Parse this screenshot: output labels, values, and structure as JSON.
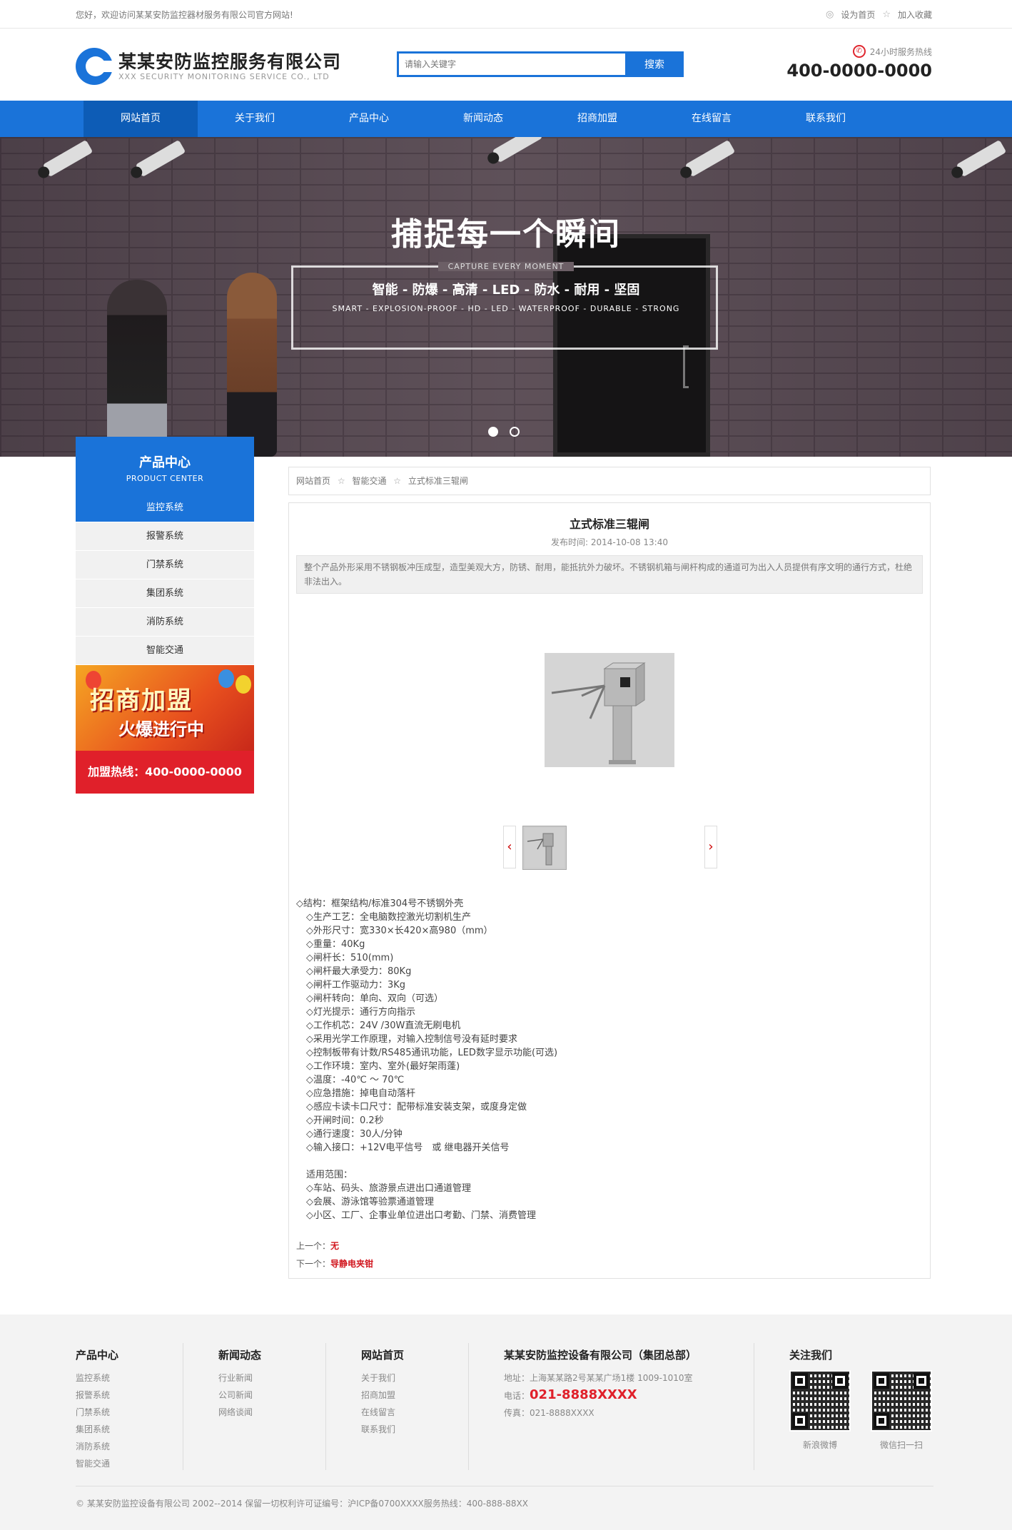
{
  "topbar": {
    "welcome": "您好，欢迎访问某某安防监控器材服务有限公司官方网站!",
    "set_home": "设为首页",
    "add_fav": "加入收藏"
  },
  "header": {
    "company_cn": "某某安防监控服务有限公司",
    "company_en": "XXX SECURITY MONITORING SERVICE CO., LTD",
    "search_placeholder": "请输入关键字",
    "search_button": "搜索",
    "hotline_label": "24小时服务热线",
    "hotline_number": "400-0000-0000"
  },
  "nav": [
    {
      "label": "网站首页",
      "active": true
    },
    {
      "label": "关于我们"
    },
    {
      "label": "产品中心"
    },
    {
      "label": "新闻动态"
    },
    {
      "label": "招商加盟"
    },
    {
      "label": "在线留言"
    },
    {
      "label": "联系我们"
    }
  ],
  "banner": {
    "title": "捕捉每一个瞬间",
    "caption": "CAPTURE EVERY MOMENT",
    "features": "智能 - 防爆 - 高清 - LED - 防水 - 耐用 - 坚固",
    "features_en": "SMART - EXPLOSION-PROOF - HD - LED - WATERPROOF - DURABLE - STRONG",
    "active_slide": 1,
    "slide_count": 2
  },
  "sidebar": {
    "title": "产品中心",
    "subtitle": "PRODUCT CENTER",
    "categories": [
      "监控系统",
      "报警系统",
      "门禁系统",
      "集团系统",
      "消防系统",
      "智能交通"
    ],
    "active_index": 0,
    "promo_line1": "招商加盟",
    "promo_line2": "火爆进行中",
    "join_hotline": "加盟热线：400-0000-0000"
  },
  "breadcrumb": [
    "网站首页",
    "智能交通",
    "立式标准三辊闸"
  ],
  "article": {
    "title": "立式标准三辊闸",
    "date": "发布时间: 2014-10-08 13:40",
    "summary": "整个产品外形采用不锈钢板冲压成型，造型美观大方，防锈、耐用，能抵抗外力破坏。不锈钢机箱与闸杆构成的通道可为出入人员提供有序文明的通行方式，杜绝非法出入。",
    "specs_first": "◇结构：框架结构/标准304号不锈钢外壳",
    "specs": [
      "◇生产工艺：全电脑数控激光切割机生产",
      "◇外形尺寸：宽330×长420×高980（mm）",
      "◇重量：40Kg",
      "◇闸杆长：510(mm)",
      "◇闸杆最大承受力：80Kg",
      "◇闸杆工作驱动力：3Kg",
      "◇闸杆转向：单向、双向（可选）",
      "◇灯光提示：通行方向指示",
      "◇工作机芯：24V /30W直流无刷电机",
      "◇采用光学工作原理，对输入控制信号没有延时要求",
      "◇控制板带有计数/RS485通讯功能，LED数字显示功能(可选)",
      "◇工作环境：室内、室外(最好架雨蓬)",
      "◇温度：-40℃ ～ 70℃",
      "◇应急措施：掉电自动落杆",
      "◇感应卡读卡口尺寸：配带标准安装支架，或度身定做",
      "◇开闸时间：0.2秒",
      "◇通行速度：30人/分钟",
      "◇输入接口：+12V电平信号　或 继电器开关信号"
    ],
    "scope_title": "适用范围：",
    "scope": [
      "◇车站、码头、旅游景点进出口通道管理",
      "◇会展、游泳馆等验票通道管理",
      "◇小区、工厂、企事业单位进出口考勤、门禁、消费管理"
    ],
    "prev_label": "上一个：",
    "prev_value": "无",
    "next_label": "下一个：",
    "next_value": "导静电夹钳"
  },
  "footer": {
    "col1": {
      "title": "产品中心",
      "links": [
        "监控系统",
        "报警系统",
        "门禁系统",
        "集团系统",
        "消防系统",
        "智能交通"
      ]
    },
    "col2": {
      "title": "新闻动态",
      "links": [
        "行业新闻",
        "公司新闻",
        "网络谈闻"
      ]
    },
    "col3": {
      "title": "网站首页",
      "links": [
        "关于我们",
        "招商加盟",
        "在线留言",
        "联系我们"
      ]
    },
    "contact": {
      "title": "某某安防监控设备有限公司（集团总部）",
      "address": "地址：上海某某路2号某某广场1楼 1009-1010室",
      "tel_label": "电话：",
      "tel": "021-8888XXXX",
      "fax": "传真：021-8888XXXX"
    },
    "follow": {
      "title": "关注我们",
      "qr1_label": "新浪微博",
      "qr2_label": "微信扫一扫"
    },
    "copyright": "© 某某安防监控设备有限公司 2002--2014 保留一切权利许可证编号：沪ICP备0700XXXX服务热线：400-888-88XX"
  }
}
